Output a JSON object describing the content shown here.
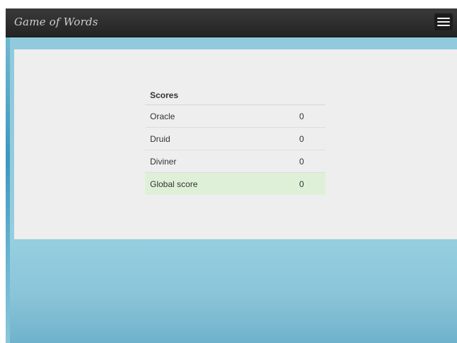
{
  "navbar": {
    "brand": "Game of Words",
    "menu_icon": "hamburger-menu-icon"
  },
  "scores": {
    "header": "Scores",
    "rows": [
      {
        "label": "Oracle",
        "value": "0"
      },
      {
        "label": "Druid",
        "value": "0"
      },
      {
        "label": "Diviner",
        "value": "0"
      }
    ],
    "global": {
      "label": "Global score",
      "value": "0"
    }
  },
  "colors": {
    "navbar": "#2b2b2b",
    "background": "#91cbdd",
    "panel": "#eeeeee",
    "global_row": "#dff0d8"
  }
}
